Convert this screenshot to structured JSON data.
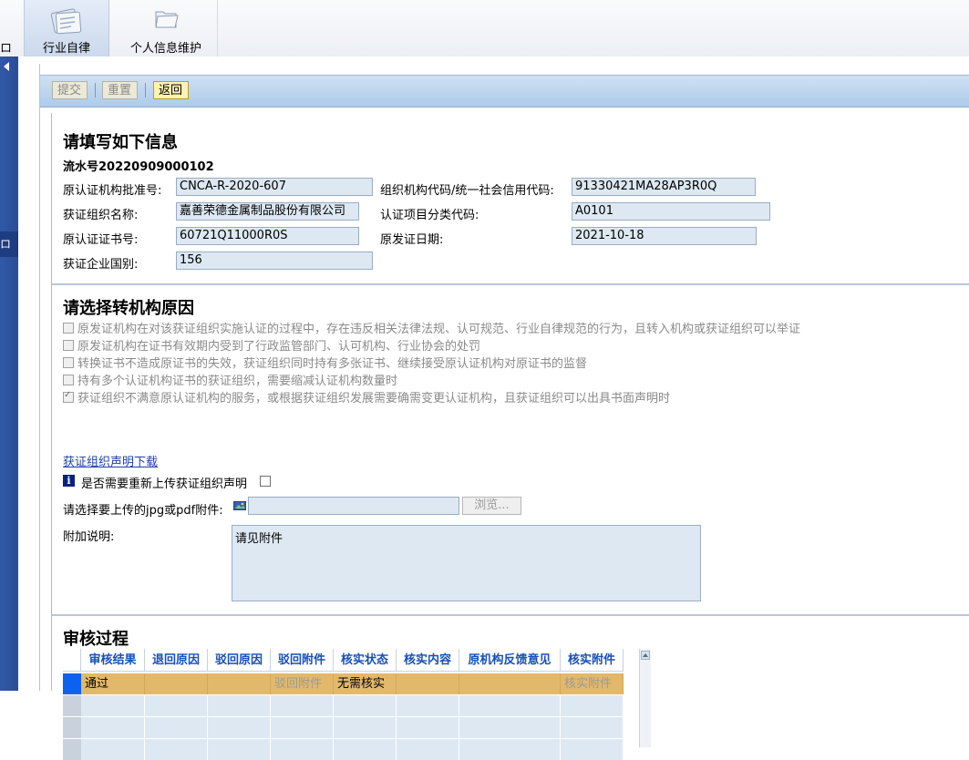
{
  "top_tabs": [
    {
      "label": "行业自律",
      "icon": "document-stack-icon",
      "active": true
    },
    {
      "label": "个人信息维护",
      "icon": "folder-icon",
      "active": false
    }
  ],
  "left_cut_glyph": "ロ",
  "left_cut_item": "ロ",
  "toolbar": {
    "submit": "提交",
    "reset": "重置",
    "back": "返回"
  },
  "info_section": {
    "title": "请填写如下信息",
    "serial": "流水号20220909000102",
    "fields": {
      "orig_approval_label": "原认证机构批准号:",
      "orig_approval_value": "CNCA-R-2020-607",
      "org_code_label": "组织机构代码/统一社会信用代码:",
      "org_code_value": "91330421MA28AP3R0Q",
      "org_name_label": "获证组织名称:",
      "org_name_value": "嘉善荣德金属制品股份有限公司",
      "category_label": "认证项目分类代码:",
      "category_value": "A0101",
      "cert_no_label": "原认证证书号:",
      "cert_no_value": "60721Q11000R0S",
      "issue_date_label": "原发证日期:",
      "issue_date_value": "2021-10-18",
      "country_label": "获证企业国别:",
      "country_value": "156"
    }
  },
  "reason_section": {
    "title": "请选择转机构原因",
    "options": [
      {
        "label": "原发证机构在对该获证组织实施认证的过程中，存在违反相关法律法规、认可规范、行业自律规范的行为，且转入机构或获证组织可以举证",
        "checked": false
      },
      {
        "label": "原发证机构在证书有效期内受到了行政监管部门、认可机构、行业协会的处罚",
        "checked": false
      },
      {
        "label": "转换证书不造成原证书的失效，获证组织同时持有多张证书、继续接受原认证机构对原证书的监督",
        "checked": false
      },
      {
        "label": "持有多个认证机构证书的获证组织，需要缩减认证机构数量时",
        "checked": false
      },
      {
        "label": "获证组织不满意原认证机构的服务，或根据获证组织发展需要确需变更认证机构，且获证组织可以出具书面声明时",
        "checked": true
      }
    ],
    "download_link": "获证组织声明下载",
    "reupload_label": "是否需要重新上传获证组织声明",
    "upload_label": "请选择要上传的jpg或pdf附件:",
    "upload_value": "",
    "browse_label": "浏览...",
    "remark_label": "附加说明:",
    "remark_value": "请见附件"
  },
  "review_section": {
    "title": "审核过程",
    "columns": [
      "审核结果",
      "退回原因",
      "驳回原因",
      "驳回附件",
      "核实状态",
      "核实内容",
      "原机构反馈意见",
      "核实附件"
    ],
    "rows": [
      [
        "通过",
        "",
        "",
        "驳回附件",
        "无需核实",
        "",
        "",
        "核实附件"
      ]
    ]
  },
  "colors": {
    "toolbar": "#aecbea",
    "nav_strip": "#2a4d97",
    "selected_row": "#e2b96a",
    "header_text": "#1650b8"
  }
}
